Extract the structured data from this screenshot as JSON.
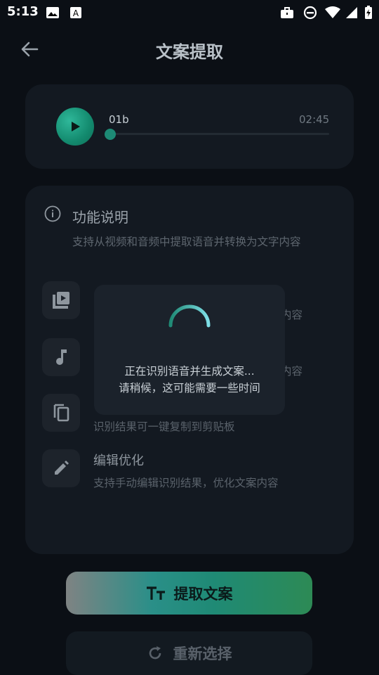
{
  "status_bar": {
    "time": "5:13"
  },
  "header": {
    "title": "文案提取"
  },
  "player": {
    "file_name": "01b",
    "duration": "02:45",
    "progress": 0.0
  },
  "info": {
    "title": "功能说明",
    "description": "支持从视频和音频中提取语音并转换为文字内容",
    "features": [
      {
        "icon": "video-file-icon",
        "title": "",
        "desc": "内容"
      },
      {
        "icon": "music-note-icon",
        "title": "",
        "desc": "内容"
      },
      {
        "icon": "copy-icon",
        "title": "",
        "desc": "识别结果可一键复制到剪贴板"
      },
      {
        "icon": "edit-pencil-icon",
        "title": "编辑优化",
        "desc": "支持手动编辑识别结果，优化文案内容"
      }
    ]
  },
  "dialog": {
    "line1": "正在识别语音并生成文案...",
    "line2": "请稍候，这可能需要一些时间"
  },
  "buttons": {
    "extract": "提取文案",
    "reselect": "重新选择"
  },
  "colors": {
    "accent": "#1f8a75",
    "background": "#0b0f15",
    "card": "#131921"
  }
}
